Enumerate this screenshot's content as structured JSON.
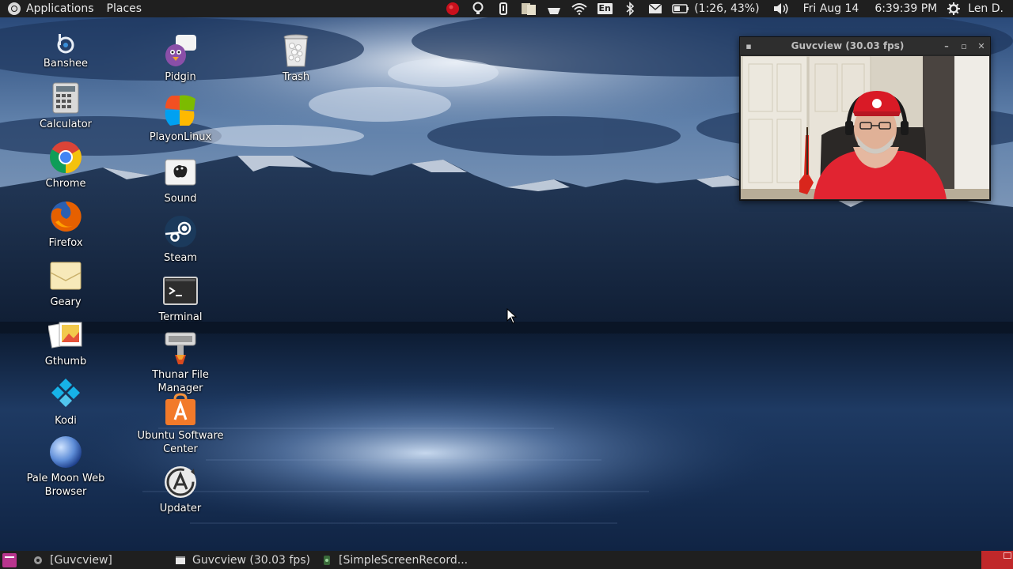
{
  "top_panel": {
    "applications_label": "Applications",
    "places_label": "Places",
    "language": "En",
    "battery": "(1:26, 43%)",
    "date": "Fri Aug 14",
    "time": "6:39:39 PM",
    "user": "Len D."
  },
  "desktop_icons": [
    {
      "label": "Banshee",
      "icon": "banshee-icon"
    },
    {
      "label": "Calculator",
      "icon": "calculator-icon"
    },
    {
      "label": "Chrome",
      "icon": "chrome-icon"
    },
    {
      "label": "Firefox",
      "icon": "firefox-icon"
    },
    {
      "label": "Geary",
      "icon": "geary-icon"
    },
    {
      "label": "Gthumb",
      "icon": "gthumb-icon"
    },
    {
      "label": "Kodi",
      "icon": "kodi-icon"
    },
    {
      "label": "Pale Moon Web Browser",
      "icon": "pale-moon-icon"
    },
    {
      "label": "Pidgin",
      "icon": "pidgin-icon"
    },
    {
      "label": "PlayonLinux",
      "icon": "playonlinux-icon"
    },
    {
      "label": "Sound",
      "icon": "sound-icon"
    },
    {
      "label": "Steam",
      "icon": "steam-icon"
    },
    {
      "label": "Terminal",
      "icon": "terminal-icon"
    },
    {
      "label": "Thunar File Manager",
      "icon": "thunar-icon"
    },
    {
      "label": "Ubuntu Software Center",
      "icon": "software-center-icon"
    },
    {
      "label": "Updater",
      "icon": "updater-icon"
    },
    {
      "label": "Trash",
      "icon": "trash-icon"
    }
  ],
  "guvcview_window": {
    "title": "Guvcview  (30.03 fps)"
  },
  "taskbar": {
    "items": [
      {
        "label": "[Guvcview]"
      },
      {
        "label": "Guvcview  (30.03 fps)"
      },
      {
        "label": "[SimpleScreenRecord..."
      }
    ]
  },
  "colors": {
    "panel_bg": "#1f1f1f",
    "workspace_switcher": "#c0282a",
    "show_desktop": "#b9358e"
  }
}
